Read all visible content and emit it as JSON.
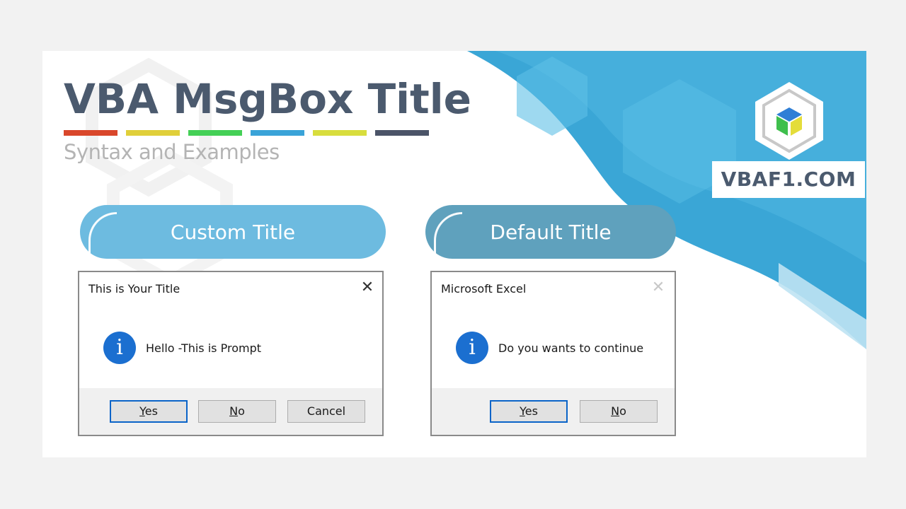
{
  "header": {
    "title": "VBA MsgBox Title",
    "subtitle": "Syntax and  Examples",
    "accent_bars": [
      "#d9472b",
      "#e0cf3a",
      "#44d056",
      "#3aa3d8",
      "#d8dd3d",
      "#4b5468"
    ]
  },
  "pills": {
    "custom": "Custom Title",
    "default": "Default Title"
  },
  "msgbox_custom": {
    "title": "This is Your Title",
    "close_glyph": "✕",
    "icon_glyph": "i",
    "prompt": "Hello -This is Prompt",
    "buttons": [
      {
        "label": "Yes",
        "access_key": "Y",
        "rest": "es"
      },
      {
        "label": "No",
        "access_key": "N",
        "rest": "o"
      },
      {
        "label": "Cancel",
        "access_key": "",
        "rest": "Cancel"
      }
    ]
  },
  "msgbox_default": {
    "title": "Microsoft Excel",
    "close_glyph": "✕",
    "icon_glyph": "i",
    "prompt": "Do you wants to continue",
    "buttons": [
      {
        "label": "Yes",
        "access_key": "Y",
        "rest": "es"
      },
      {
        "label": "No",
        "access_key": "N",
        "rest": "o"
      }
    ]
  },
  "brand": {
    "name": "VBAF1.COM",
    "icon": "vbaf1-hex-cube-logo"
  },
  "colors": {
    "blue_swoosh": "#2ea1d4",
    "info_icon": "#1b6fd0",
    "default_button_border": "#0a64c8"
  }
}
